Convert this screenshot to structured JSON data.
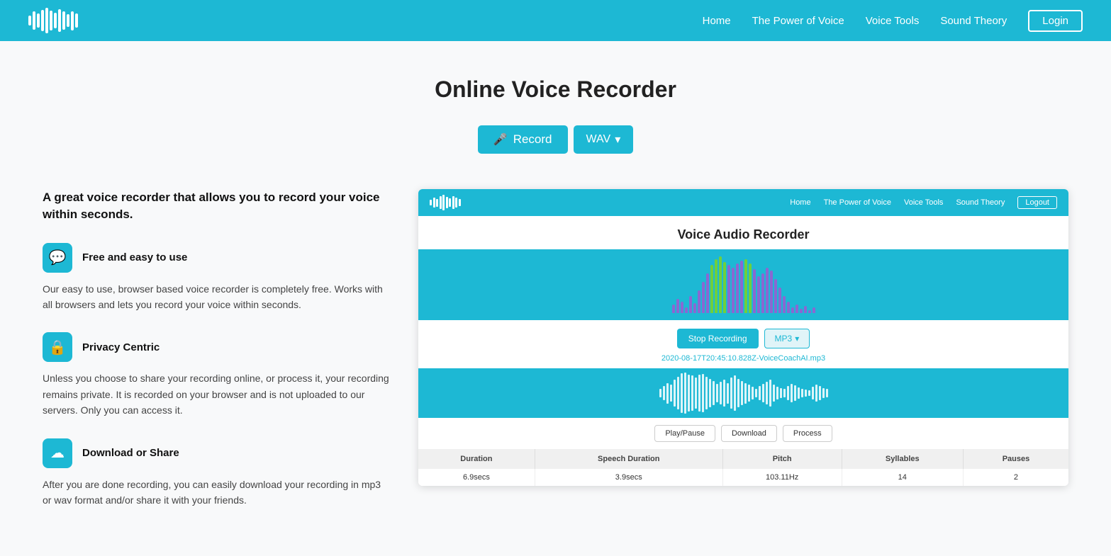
{
  "header": {
    "nav": {
      "home": "Home",
      "power_of_voice": "The Power of Voice",
      "voice_tools": "Voice Tools",
      "sound_theory": "Sound Theory",
      "login": "Login"
    }
  },
  "main": {
    "title": "Online Voice Recorder",
    "record_button": "Record",
    "wav_button": "WAV",
    "tagline": "A great voice recorder that allows you to record your voice within seconds.",
    "features": [
      {
        "icon": "💬",
        "title": "Free and easy to use",
        "desc": "Our easy to use, browser based voice recorder is completely free. Works with all browsers and lets you record your voice within seconds."
      },
      {
        "icon": "🔒",
        "title": "Privacy Centric",
        "desc": "Unless you choose to share your recording online, or process it, your recording remains private. It is recorded on your browser and is not uploaded to our servers. Only you can access it."
      },
      {
        "icon": "☁",
        "title": "Download or Share",
        "desc": "After you are done recording, you can easily download your recording in mp3 or wav format and/or share it with your friends."
      }
    ]
  },
  "preview": {
    "header": {
      "nav": {
        "home": "Home",
        "power_of_voice": "The Power of Voice",
        "voice_tools": "Voice Tools",
        "sound_theory": "Sound Theory",
        "logout": "Logout"
      }
    },
    "title": "Voice Audio Recorder",
    "stop_button": "Stop Recording",
    "mp3_button": "MP3",
    "filename": "2020-08-17T20:45:10.828Z-VoiceCoachAI.mp3",
    "controls": {
      "play_pause": "Play/Pause",
      "download": "Download",
      "process": "Process"
    },
    "stats": {
      "headers": [
        "Duration",
        "Speech Duration",
        "Pitch",
        "Syllables",
        "Pauses"
      ],
      "values": [
        "6.9secs",
        "3.9secs",
        "103.11Hz",
        "14",
        "2"
      ]
    }
  }
}
